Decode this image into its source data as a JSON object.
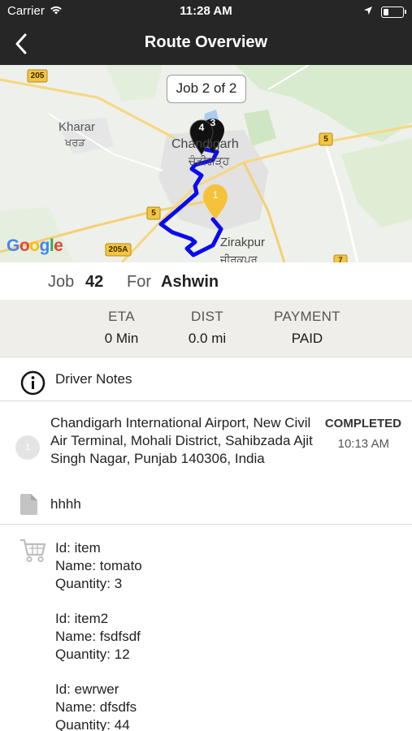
{
  "status_bar": {
    "carrier": "Carrier",
    "time": "11:28 AM",
    "battery_level": 0.25
  },
  "nav": {
    "title": "Route Overview"
  },
  "map": {
    "job_chip": "Job 2 of 2",
    "logo": "Google",
    "labels": {
      "kharar": "Kharar",
      "kharar_pa": "ਖਰੜ",
      "chandigarh": "Chandigarh",
      "chandigarh_pa": "ਚੰਡੀਗੜ੍ਹ",
      "zirakpur": "Zirakpur",
      "zirakpur_pa": "ਜ਼ੀਰਕਪੁਰ"
    },
    "road_shields": {
      "r205": "205",
      "r5a": "5",
      "r5b": "5",
      "r205a": "205A",
      "r7": "7"
    },
    "markers": {
      "black_a": "4",
      "black_b": "3",
      "yellow": "1"
    },
    "colors": {
      "route": "#0a0af0",
      "marker_dark": "#111111",
      "marker_yellow": "#f5c23a"
    }
  },
  "job": {
    "job_label": "Job",
    "job_number": "42",
    "for_label": "For",
    "customer": "Ashwin"
  },
  "stats": {
    "eta_label": "ETA",
    "eta_value": "0 Min",
    "dist_label": "DIST",
    "dist_value": "0.0 mi",
    "payment_label": "PAYMENT",
    "payment_value": "PAID"
  },
  "driver_notes": {
    "label": "Driver Notes"
  },
  "stop": {
    "sequence": "1",
    "address": "Chandigarh International Airport, New Civil Air Terminal, Mohali District, Sahibzada Ajit Singh Nagar, Punjab 140306, India",
    "status": "COMPLETED",
    "time": "10:13 AM",
    "note": "hhhh"
  },
  "items": [
    {
      "id": "Id: item",
      "name": "Name: tomato",
      "quantity": "Quantity: 3"
    },
    {
      "id": "Id: item2",
      "name": "Name: fsdfsdf",
      "quantity": "Quantity: 12"
    },
    {
      "id": "Id: ewrwer",
      "name": "Name: dfsdfs",
      "quantity": "Quantity: 44"
    }
  ]
}
